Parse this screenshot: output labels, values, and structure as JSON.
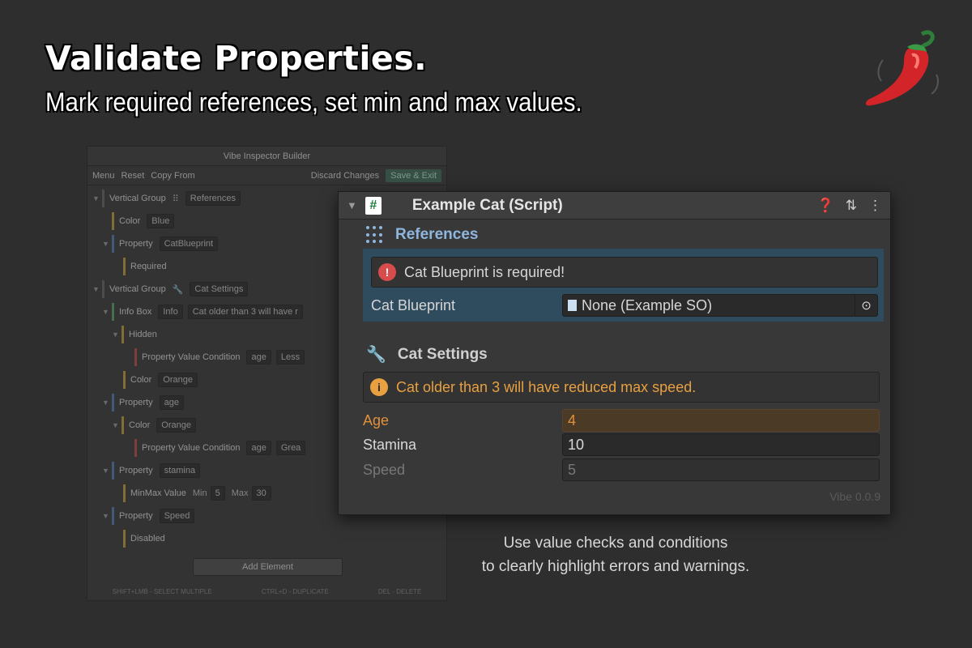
{
  "headline": "Validate Properties.",
  "subline": "Mark required references, set min and max values.",
  "builder": {
    "title": "Vibe Inspector Builder",
    "toolbar": {
      "menu": "Menu",
      "reset": "Reset",
      "copy_from": "Copy From",
      "discard": "Discard Changes",
      "save": "Save & Exit"
    },
    "rows": [
      {
        "label": "Vertical Group",
        "dd": "References"
      },
      {
        "label": "Color",
        "dd": "Blue"
      },
      {
        "label": "Property",
        "dd": "CatBlueprint"
      },
      {
        "label": "Required"
      },
      {
        "label": "Vertical Group",
        "dd": "Cat Settings"
      },
      {
        "label": "Info Box",
        "dd": "Info",
        "txt": "Cat older than 3 will have r"
      },
      {
        "label": "Hidden"
      },
      {
        "label": "Property Value Condition",
        "dd": "age",
        "txt": "Less"
      },
      {
        "label": "Color",
        "dd": "Orange"
      },
      {
        "label": "Property",
        "dd": "age"
      },
      {
        "label": "Color",
        "dd": "Orange"
      },
      {
        "label": "Property Value Condition",
        "dd": "age",
        "txt": "Grea"
      },
      {
        "label": "Property",
        "dd": "stamina"
      },
      {
        "label": "MinMax Value",
        "min_label": "Min",
        "min": "5",
        "max_label": "Max",
        "max": "30"
      },
      {
        "label": "Property",
        "dd": "Speed"
      },
      {
        "label": "Disabled"
      }
    ],
    "add_element": "Add Element",
    "hints": [
      "SHIFT+LMB - SELECT MULTIPLE",
      "CTRL+D - DUPLICATE",
      "DEL - DELETE"
    ]
  },
  "inspector": {
    "title": "Example Cat (Script)",
    "script_glyph": "#",
    "references_header": "References",
    "error_msg": "Cat Blueprint is required!",
    "blueprint_label": "Cat Blueprint",
    "blueprint_value": "None (Example SO)",
    "settings_header": "Cat Settings",
    "info_msg": "Cat older than 3 will have reduced max speed.",
    "age_label": "Age",
    "age_value": "4",
    "stamina_label": "Stamina",
    "stamina_value": "10",
    "speed_label": "Speed",
    "speed_value": "5",
    "version": "Vibe 0.0.9"
  },
  "caption": [
    "Use value checks and conditions",
    "to clearly highlight errors and warnings."
  ],
  "colors": {
    "accent_blue": "#8fb6de",
    "warning": "#e8a040",
    "error": "#d94c4c"
  }
}
